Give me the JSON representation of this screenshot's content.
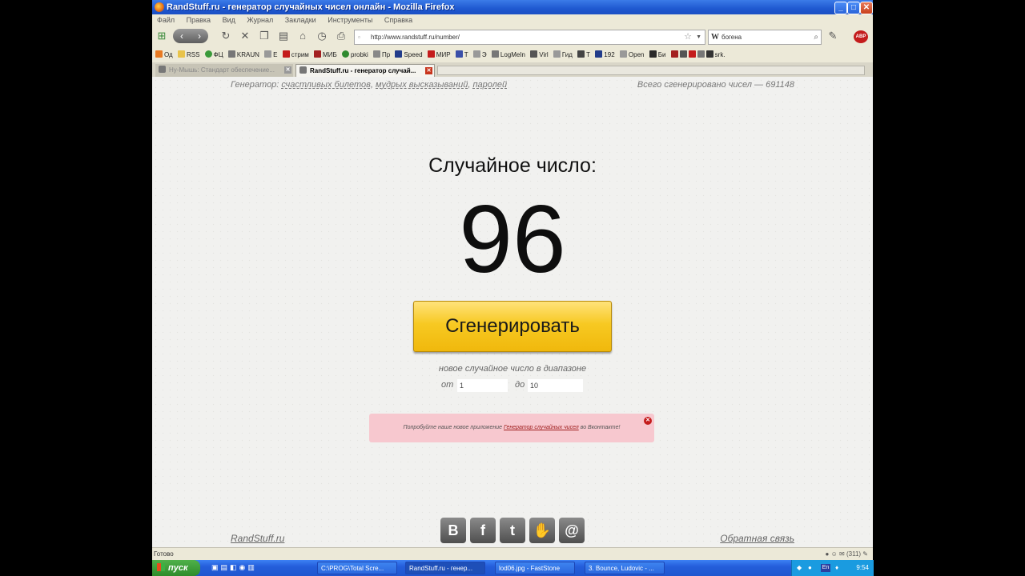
{
  "window": {
    "title": "RandStuff.ru - генератор случайных чисел онлайн - Mozilla Firefox",
    "minimize": "_",
    "maximize": "□",
    "close": "✕"
  },
  "menu": [
    "Файл",
    "Правка",
    "Вид",
    "Журнал",
    "Закладки",
    "Инструменты",
    "Справка"
  ],
  "toolbar": {
    "url": "http://www.randstuff.ru/number/",
    "search_value": "богена",
    "search_engine_label": "W",
    "abp_label": "ABP"
  },
  "bookmarks": [
    "Од",
    "RSS",
    "ФЦ",
    "KRAUN",
    "E",
    "стрим",
    "МИБ",
    "probki",
    "Пр",
    "Speed",
    "МИР",
    "T",
    "Э",
    "LogMeIn",
    "Virl",
    "Гид",
    "T",
    "192",
    "Open",
    "Би",
    "srk."
  ],
  "tabs": {
    "inactive": "Ну-Мышь: Стандарт обеспечение...",
    "active": "RandStuff.ru - генератор случай..."
  },
  "page": {
    "gen_prefix": "Генератор:",
    "gen_links": [
      "счастливых билетов",
      "мудрых высказываний",
      "паролей"
    ],
    "total": "Всего сгенерировано чисел — 691148",
    "random_label": "Случайное число:",
    "random_value": "96",
    "generate_button": "Сгенерировать",
    "range_caption": "новое случайное число в диапазоне",
    "from_label": "от",
    "from_value": "1",
    "to_label": "до",
    "to_value": "10",
    "notice_before": "Попробуйте наше новое приложение",
    "notice_link": "Генератор случайных чисел",
    "notice_after": "во Вконтакте!",
    "footer_logo": "RandStuff.ru",
    "feedback": "Обратная связь",
    "social": [
      "В",
      "f",
      "t",
      "✋",
      "@"
    ]
  },
  "status": {
    "text": "Готово",
    "tray_icons": "(311)"
  },
  "taskbar": {
    "start": "пуск",
    "tasks": [
      "C:\\PROG\\Total Scre...",
      "RandStuff.ru - генер...",
      "lod06.jpg - FastStone",
      "3. Bounce, Ludovic - ..."
    ],
    "lang": "En",
    "clock": "9:54"
  }
}
